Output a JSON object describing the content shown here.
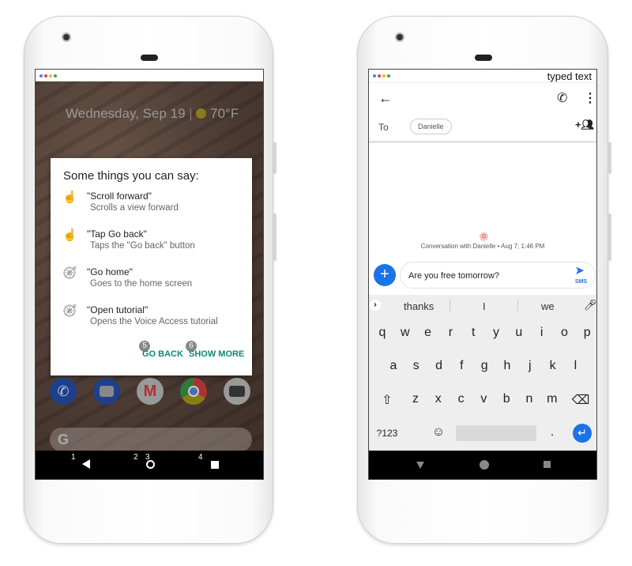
{
  "left_phone": {
    "lockscreen": {
      "date": "Wednesday, Sep 19",
      "temperature": "70°F"
    },
    "dialog": {
      "title": "Some things you can say:",
      "items": [
        {
          "command": "\"Scroll  forward\"",
          "description": "Scrolls a view forward",
          "icon": "touch-icon"
        },
        {
          "command": "\"Tap Go back\"",
          "description": "Taps the \"Go back\" button",
          "icon": "touch-icon"
        },
        {
          "command": "\"Go home\"",
          "description": "Goes to the home screen",
          "icon": "compass-icon"
        },
        {
          "command": "\"Open tutorial\"",
          "description": "Opens the Voice Access tutorial",
          "icon": "compass-icon"
        }
      ],
      "go_back": {
        "label": "GO BACK",
        "badge": "5"
      },
      "show_more": {
        "label": "SHOW MORE",
        "badge": "6"
      }
    },
    "dock": [
      "phone",
      "messages",
      "gmail",
      "chrome",
      "camera"
    ],
    "search_logo": "G",
    "nav_numbers": {
      "back": "1",
      "home_a": "2",
      "home_b": "3",
      "recents": "4"
    },
    "accent": "#0b8a75"
  },
  "right_phone": {
    "status_text": "typed text",
    "to_label": "To",
    "recipient": "Danielle",
    "avatar_letter": "D",
    "conversation_info": "Conversation with Danielle • Aug 7, 1:46 PM",
    "message": "Are you free tomorrow?",
    "send_label": "SMS",
    "suggestions": [
      "thanks",
      "I",
      "we"
    ],
    "keys": {
      "row1": [
        "q",
        "w",
        "e",
        "r",
        "t",
        "y",
        "u",
        "i",
        "o",
        "p"
      ],
      "row2": [
        "a",
        "s",
        "d",
        "f",
        "g",
        "h",
        "j",
        "k",
        "l"
      ],
      "row3": [
        "z",
        "x",
        "c",
        "v",
        "b",
        "n",
        "m"
      ],
      "symbols": "?123",
      "period": "."
    },
    "accent": "#1a73e8"
  }
}
